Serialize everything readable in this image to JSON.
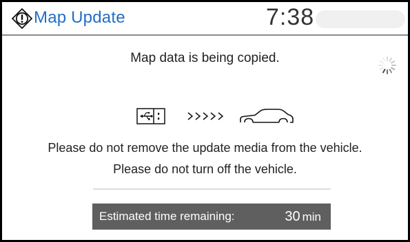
{
  "header": {
    "title": "Map Update",
    "time": "7:38",
    "icon": "warning-circle-icon",
    "title_color": "#1f6fc5"
  },
  "main": {
    "status_message": "Map data is being copied.",
    "activity_icon": "loading-spinner-icon",
    "transfer_diagram": {
      "source_icon": "usb-media-icon",
      "arrows": ">>>>>",
      "target_icon": "car-icon"
    },
    "warnings": [
      "Please do not remove the update media from the vehicle.",
      "Please do not turn off the vehicle."
    ]
  },
  "footer": {
    "eta_label": "Estimated time remaining:",
    "eta_value": "30",
    "eta_unit": "min",
    "bar_color": "#5f5f5f"
  }
}
